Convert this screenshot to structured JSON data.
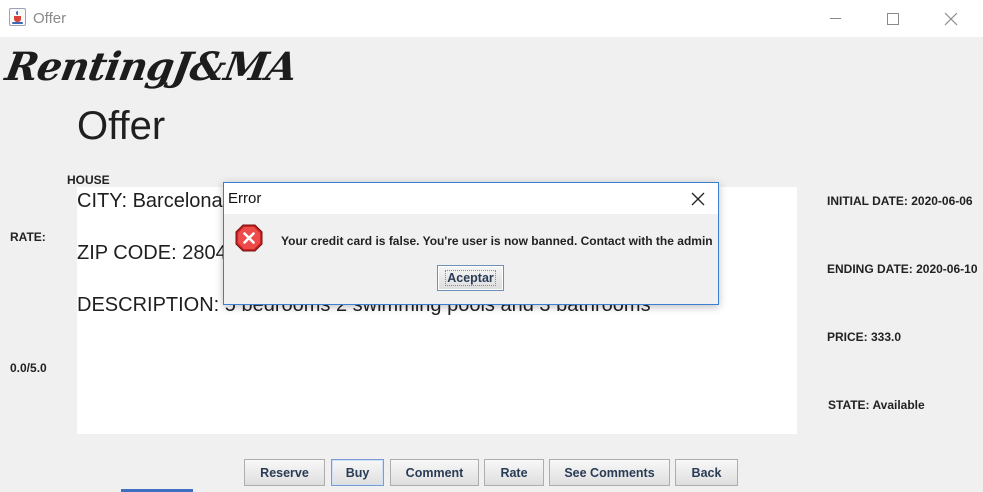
{
  "window": {
    "title": "Offer",
    "controls": [
      "minimize-icon",
      "maximize-icon",
      "close-icon"
    ]
  },
  "logo": {
    "text": "RentingJ&MA"
  },
  "page": {
    "title": "Offer",
    "category": "HOUSE"
  },
  "rating": {
    "label": "RATE:",
    "value": "0.0/5.0"
  },
  "details": {
    "city": "CITY: Barcelona",
    "zip": "ZIP CODE: 2804",
    "description": "DESCRIPTION: 5 bedrooms 2 swimming pools and 3 bathrooms"
  },
  "info": {
    "initial_date": "INITIAL DATE: 2020-06-06",
    "ending_date": "ENDING DATE: 2020-06-10",
    "price": "PRICE: 333.0",
    "state": "STATE: Available"
  },
  "buttons": {
    "reserve": "Reserve",
    "buy": "Buy",
    "comment": "Comment",
    "rate": "Rate",
    "see_comments": "See Comments",
    "back": "Back"
  },
  "dialog": {
    "title": "Error",
    "message": "Your credit card is false. You're user is now banned. Contact with the admin",
    "ok_label": "Aceptar",
    "icon": "error-icon"
  },
  "colors": {
    "background": "#f0f0f0",
    "dialog_border": "#3c7fd1",
    "error_icon": "#d42a2a"
  }
}
